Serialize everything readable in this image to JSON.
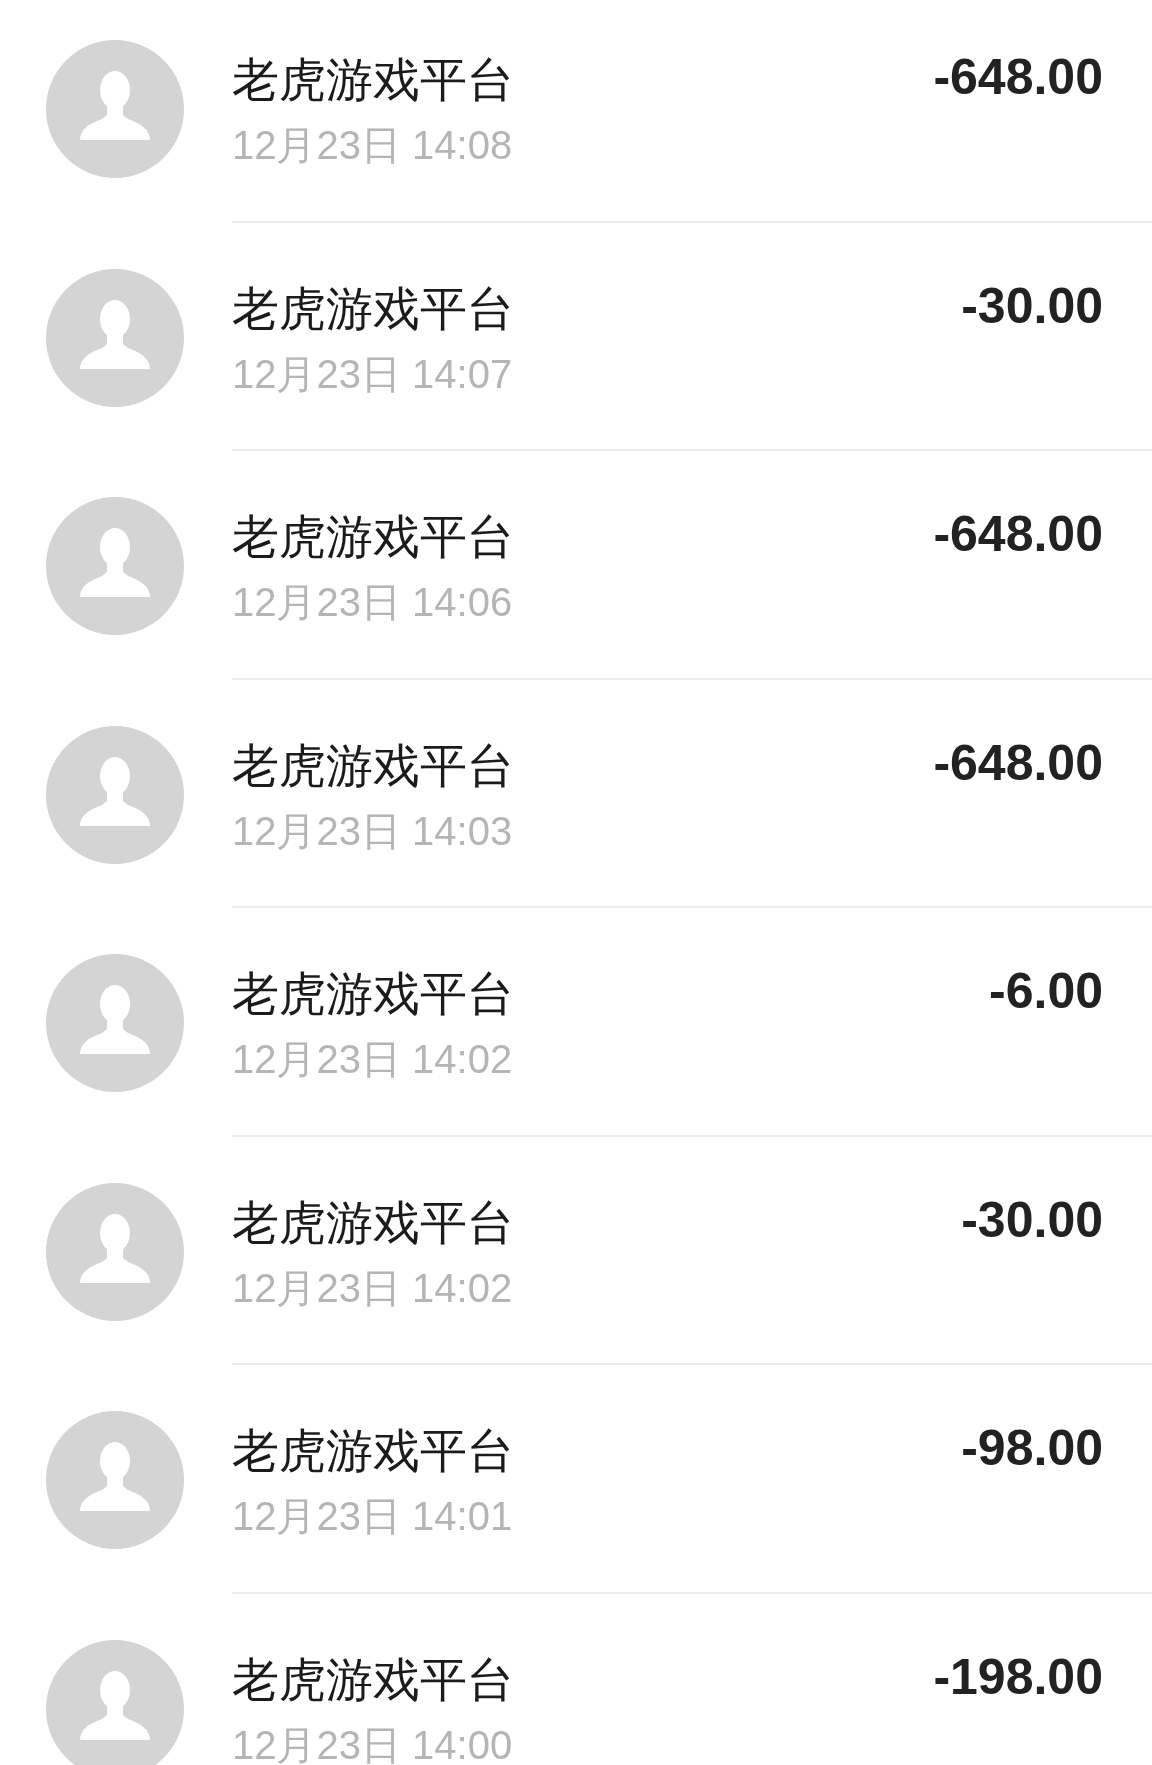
{
  "transactions": [
    {
      "name": "老虎游戏平台",
      "time": "12月23日 14:08",
      "amount": "-648.00"
    },
    {
      "name": "老虎游戏平台",
      "time": "12月23日 14:07",
      "amount": "-30.00"
    },
    {
      "name": "老虎游戏平台",
      "time": "12月23日 14:06",
      "amount": "-648.00"
    },
    {
      "name": "老虎游戏平台",
      "time": "12月23日 14:03",
      "amount": "-648.00"
    },
    {
      "name": "老虎游戏平台",
      "time": "12月23日 14:02",
      "amount": "-6.00"
    },
    {
      "name": "老虎游戏平台",
      "time": "12月23日 14:02",
      "amount": "-30.00"
    },
    {
      "name": "老虎游戏平台",
      "time": "12月23日 14:01",
      "amount": "-98.00"
    },
    {
      "name": "老虎游戏平台",
      "time": "12月23日 14:00",
      "amount": "-198.00"
    }
  ]
}
